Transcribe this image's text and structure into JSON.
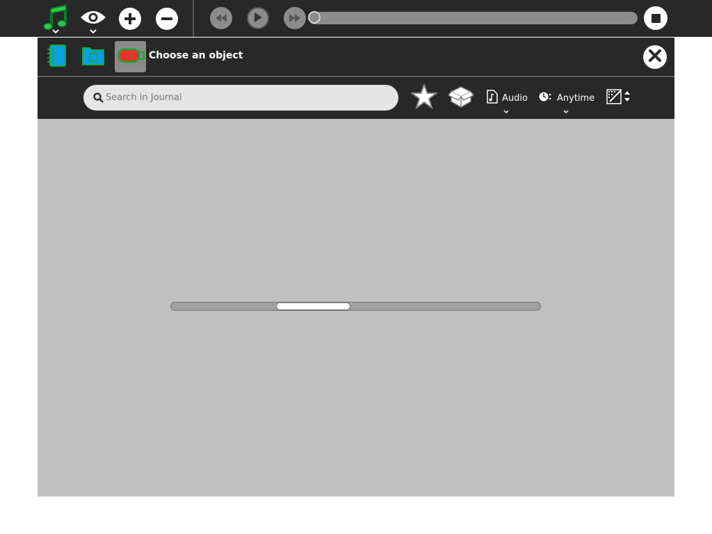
{
  "toolbar": {
    "activity_icon": "music-note-icon",
    "view_icon": "eye-icon",
    "zoom_in_icon": "plus-icon",
    "zoom_out_icon": "minus-icon",
    "rewind_icon": "rewind-icon",
    "play_icon": "play-icon",
    "forward_icon": "fast-forward-icon",
    "stop_icon": "stop-icon",
    "playback_progress": 0,
    "colors": {
      "background": "#282828",
      "activity_green": "#2ec84a",
      "media_gray": "#8c8c8c"
    }
  },
  "dialog": {
    "title": "Choose an object",
    "tabs": [
      {
        "icon": "journal-icon",
        "active": false
      },
      {
        "icon": "documents-folder-icon",
        "active": false
      },
      {
        "icon": "usb-drive-icon",
        "active": true
      }
    ],
    "close_icon": "close-icon",
    "search": {
      "placeholder": "Search in Journal",
      "value": ""
    },
    "favorites_icon": "star-icon",
    "shared_icon": "box-icon",
    "type_filter": {
      "icon": "audio-file-icon",
      "label": "Audio"
    },
    "date_filter": {
      "icon": "clock-icon",
      "label": "Anytime"
    },
    "sort_icon": "sort-icon",
    "busy_indicator_position": 0.28,
    "colors": {
      "content_bg": "#c0c0c0"
    }
  }
}
